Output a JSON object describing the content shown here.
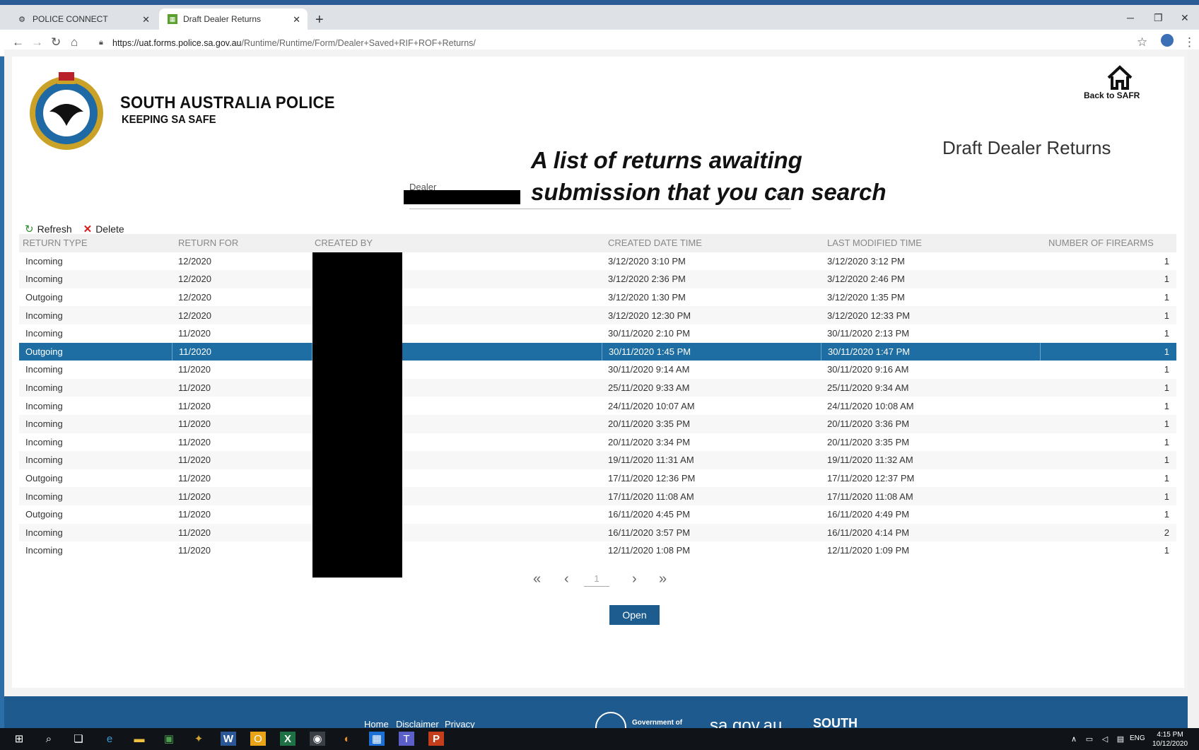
{
  "browser": {
    "tabs": [
      {
        "title": "POLICE CONNECT",
        "active": false
      },
      {
        "title": "Draft Dealer Returns",
        "active": true
      }
    ],
    "url_host": "https://uat.forms.police.sa.gov.au",
    "url_path": "/Runtime/Runtime/Form/Dealer+Saved+RIF+ROF+Returns/"
  },
  "header": {
    "org_name": "SOUTH AUSTRALIA POLICE",
    "org_motto": "KEEPING SA SAFE",
    "back_link": "Back to SAFR",
    "page_title": "Draft Dealer Returns"
  },
  "annotation": {
    "line1": "A list of returns awaiting",
    "line2": "submission that you can search"
  },
  "dealer": {
    "label": "Dealer"
  },
  "toolbar": {
    "refresh": "Refresh",
    "delete": "Delete"
  },
  "grid": {
    "columns": [
      "RETURN TYPE",
      "RETURN FOR",
      "CREATED BY",
      "CREATED DATE TIME",
      "LAST MODIFIED TIME",
      "NUMBER OF FIREARMS"
    ],
    "selected_index": 5,
    "rows": [
      {
        "type": "Incoming",
        "for": "12/2020",
        "created": "3/12/2020 3:10 PM",
        "modified": "3/12/2020 3:12 PM",
        "num": "1"
      },
      {
        "type": "Incoming",
        "for": "12/2020",
        "created": "3/12/2020 2:36 PM",
        "modified": "3/12/2020 2:46 PM",
        "num": "1"
      },
      {
        "type": "Outgoing",
        "for": "12/2020",
        "created": "3/12/2020 1:30 PM",
        "modified": "3/12/2020 1:35 PM",
        "num": "1"
      },
      {
        "type": "Incoming",
        "for": "12/2020",
        "created": "3/12/2020 12:30 PM",
        "modified": "3/12/2020 12:33 PM",
        "num": "1"
      },
      {
        "type": "Incoming",
        "for": "11/2020",
        "created": "30/11/2020 2:10 PM",
        "modified": "30/11/2020 2:13 PM",
        "num": "1"
      },
      {
        "type": "Outgoing",
        "for": "11/2020",
        "created": "30/11/2020 1:45 PM",
        "modified": "30/11/2020 1:47 PM",
        "num": "1"
      },
      {
        "type": "Incoming",
        "for": "11/2020",
        "created": "30/11/2020 9:14 AM",
        "modified": "30/11/2020 9:16 AM",
        "num": "1"
      },
      {
        "type": "Incoming",
        "for": "11/2020",
        "created": "25/11/2020 9:33 AM",
        "modified": "25/11/2020 9:34 AM",
        "num": "1"
      },
      {
        "type": "Incoming",
        "for": "11/2020",
        "created": "24/11/2020 10:07 AM",
        "modified": "24/11/2020 10:08 AM",
        "num": "1"
      },
      {
        "type": "Incoming",
        "for": "11/2020",
        "created": "20/11/2020 3:35 PM",
        "modified": "20/11/2020 3:36 PM",
        "num": "1"
      },
      {
        "type": "Incoming",
        "for": "11/2020",
        "created": "20/11/2020 3:34 PM",
        "modified": "20/11/2020 3:35 PM",
        "num": "1"
      },
      {
        "type": "Incoming",
        "for": "11/2020",
        "created": "19/11/2020 11:31 AM",
        "modified": "19/11/2020 11:32 AM",
        "num": "1"
      },
      {
        "type": "Outgoing",
        "for": "11/2020",
        "created": "17/11/2020 12:36 PM",
        "modified": "17/11/2020 12:37 PM",
        "num": "1"
      },
      {
        "type": "Incoming",
        "for": "11/2020",
        "created": "17/11/2020 11:08 AM",
        "modified": "17/11/2020 11:08 AM",
        "num": "1"
      },
      {
        "type": "Outgoing",
        "for": "11/2020",
        "created": "16/11/2020 4:45 PM",
        "modified": "16/11/2020 4:49 PM",
        "num": "1"
      },
      {
        "type": "Incoming",
        "for": "11/2020",
        "created": "16/11/2020 3:57 PM",
        "modified": "16/11/2020 4:14 PM",
        "num": "2"
      },
      {
        "type": "Incoming",
        "for": "11/2020",
        "created": "12/11/2020 1:08 PM",
        "modified": "12/11/2020 1:09 PM",
        "num": "1"
      }
    ]
  },
  "pager": {
    "current_page": "1"
  },
  "open_button": "Open",
  "footer": {
    "links": [
      "Home",
      "Disclaimer",
      "Privacy"
    ],
    "gov_text": "Government of",
    "sagov": "sa.gov.au",
    "south": "SOUTH"
  },
  "taskbar": {
    "lang": "ENG",
    "time": "4:15 PM",
    "date": "10/12/2020"
  },
  "colors": {
    "accent": "#1e6ea3",
    "button": "#1d5c8f",
    "footer": "#1f5a8f"
  }
}
